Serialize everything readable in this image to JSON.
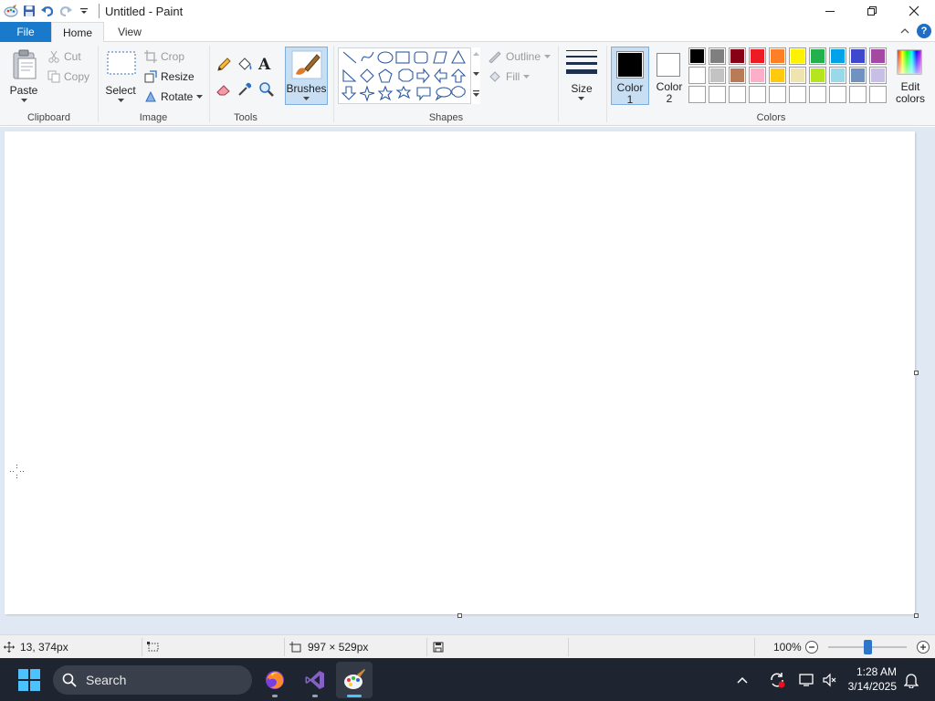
{
  "window": {
    "title": "Untitled - Paint"
  },
  "tabs": {
    "file": "File",
    "home": "Home",
    "view": "View"
  },
  "clipboard": {
    "paste": "Paste",
    "cut": "Cut",
    "copy": "Copy",
    "label": "Clipboard"
  },
  "image": {
    "select": "Select",
    "crop": "Crop",
    "resize": "Resize",
    "rotate": "Rotate",
    "label": "Image"
  },
  "tools": {
    "label": "Tools"
  },
  "brushes": {
    "label": "Brushes"
  },
  "shapes": {
    "outline": "Outline",
    "fill": "Fill",
    "label": "Shapes"
  },
  "size": {
    "label": "Size"
  },
  "colors": {
    "color1_line1": "Color",
    "color1_line2": "1",
    "color2_line1": "Color",
    "color2_line2": "2",
    "edit_line1": "Edit",
    "edit_line2": "colors",
    "label": "Colors",
    "color1_value": "#000000",
    "color2_value": "#ffffff",
    "palette_row1": [
      "#000000",
      "#7f7f7f",
      "#880015",
      "#ed1c24",
      "#ff7f27",
      "#fff200",
      "#22b14c",
      "#00a2e8",
      "#3f48cc",
      "#a349a4"
    ],
    "palette_row2": [
      "#ffffff",
      "#c3c3c3",
      "#b97a57",
      "#ffaec9",
      "#ffc90e",
      "#efe4b0",
      "#b5e61d",
      "#99d9ea",
      "#7092be",
      "#c8bfe7"
    ],
    "palette_row3": [
      "#ffffff",
      "#ffffff",
      "#ffffff",
      "#ffffff",
      "#ffffff",
      "#ffffff",
      "#ffffff",
      "#ffffff",
      "#ffffff",
      "#ffffff"
    ]
  },
  "status": {
    "cursor_pos": "13, 374px",
    "canvas_size": "997 × 529px",
    "zoom": "100%",
    "zoom_fraction": 0.5
  },
  "taskbar": {
    "search_placeholder": "Search",
    "time": "1:28 AM",
    "date": "3/14/2025"
  }
}
